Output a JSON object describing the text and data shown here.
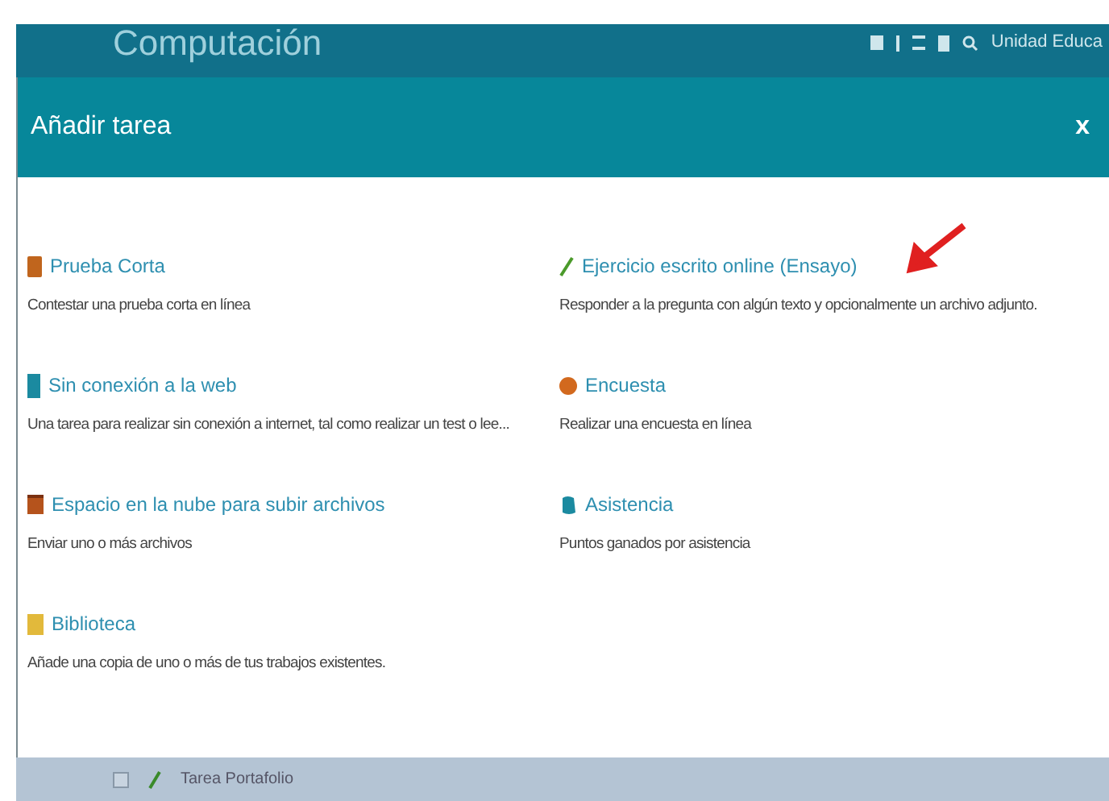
{
  "page_header": {
    "title": "Computación",
    "user": "Unidad Educa"
  },
  "dialog": {
    "title": "Añadir tarea",
    "close": "x",
    "columns": [
      [
        {
          "kind": "quiz",
          "title": "Prueba Corta",
          "description": "Contestar una prueba corta en línea"
        },
        {
          "kind": "offline",
          "title": "Sin conexión a la web",
          "description": "Una tarea para realizar sin conexión a internet, tal como realizar un test o lee..."
        },
        {
          "kind": "upload",
          "title": "Espacio en la nube para subir archivos",
          "description": "Enviar uno o más archivos"
        },
        {
          "kind": "library",
          "title": "Biblioteca",
          "description": "Añade una copia de uno o más de tus trabajos existentes."
        }
      ],
      [
        {
          "kind": "essay",
          "title": "Ejercicio escrito online (Ensayo)",
          "description": "Responder a la pregunta con algún texto y opcionalmente un archivo adjunto."
        },
        {
          "kind": "survey",
          "title": "Encuesta",
          "description": "Realizar una encuesta en línea"
        },
        {
          "kind": "attendance",
          "title": "Asistencia",
          "description": "Puntos ganados por asistencia"
        }
      ]
    ]
  },
  "background_row": {
    "checked": false,
    "title": "Tarea Portafolio"
  }
}
